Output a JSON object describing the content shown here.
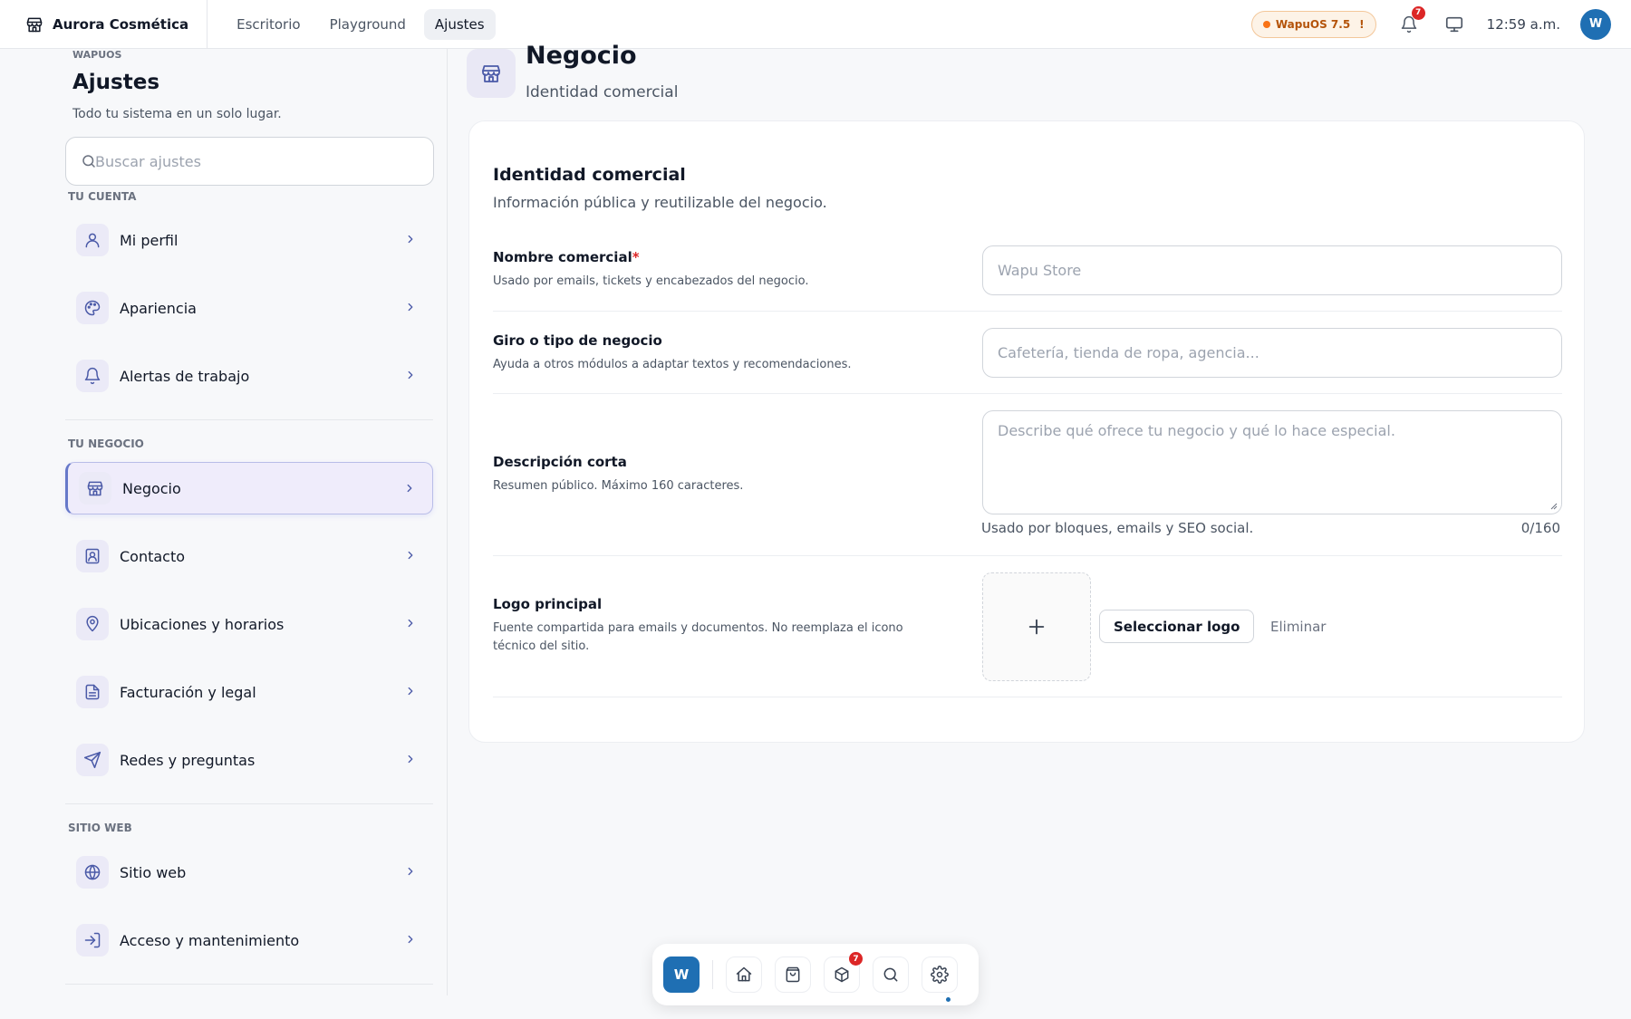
{
  "topbar": {
    "brand": "Aurora Cosmética",
    "tabs": [
      {
        "label": "Escritorio",
        "active": false
      },
      {
        "label": "Playground",
        "active": false
      },
      {
        "label": "Ajustes",
        "active": true
      }
    ],
    "version": "WapuOS 7.5",
    "version_alert": "!",
    "notifications_count": "7",
    "clock": "12:59 a.m.",
    "avatar_initial": "W",
    "accent_color": "#1f6fb3"
  },
  "sidebar": {
    "eyebrow": "WAPUOS",
    "title": "Ajustes",
    "subtitle": "Todo tu sistema en un solo lugar.",
    "search_placeholder": "Buscar ajustes",
    "sections": [
      {
        "title": "TU CUENTA",
        "items": [
          {
            "label": "Mi perfil",
            "icon": "user-icon"
          },
          {
            "label": "Apariencia",
            "icon": "palette-icon"
          },
          {
            "label": "Alertas de trabajo",
            "icon": "bell-icon"
          }
        ]
      },
      {
        "title": "TU NEGOCIO",
        "items": [
          {
            "label": "Negocio",
            "icon": "store-icon",
            "active": true
          },
          {
            "label": "Contacto",
            "icon": "contact-icon"
          },
          {
            "label": "Ubicaciones y horarios",
            "icon": "map-pin-icon"
          },
          {
            "label": "Facturación y legal",
            "icon": "document-icon"
          },
          {
            "label": "Redes y preguntas",
            "icon": "send-icon"
          }
        ]
      },
      {
        "title": "SITIO WEB",
        "items": [
          {
            "label": "Sitio web",
            "icon": "globe-icon"
          },
          {
            "label": "Acceso y mantenimiento",
            "icon": "login-icon"
          }
        ]
      }
    ]
  },
  "page": {
    "title": "Negocio",
    "subtitle": "Identidad comercial"
  },
  "card": {
    "title": "Identidad comercial",
    "subtitle": "Información pública y reutilizable del negocio.",
    "fields": {
      "nombre": {
        "label": "Nombre comercial",
        "required_mark": "*",
        "help": "Usado por emails, tickets y encabezados del negocio.",
        "placeholder": "Wapu Store",
        "value": ""
      },
      "giro": {
        "label": "Giro o tipo de negocio",
        "help": "Ayuda a otros módulos a adaptar textos y recomendaciones.",
        "placeholder": "Cafetería, tienda de ropa, agencia...",
        "value": ""
      },
      "descripcion": {
        "label": "Descripción corta",
        "help": "Resumen público. Máximo 160 caracteres.",
        "placeholder": "Describe qué ofrece tu negocio y qué lo hace especial.",
        "value": "",
        "hint": "Usado por bloques, emails y SEO social.",
        "counter": "0/160"
      },
      "logo": {
        "label": "Logo principal",
        "help": "Fuente compartida para emails y documentos. No reemplaza el icono técnico del sitio.",
        "select_label": "Seleccionar logo",
        "delete_label": "Eliminar"
      }
    }
  },
  "dock": {
    "app_initial": "W",
    "items": [
      "home-icon",
      "bag-icon",
      "box-icon",
      "search-icon",
      "gear-icon"
    ],
    "box_badge": "7",
    "active": "gear-icon"
  }
}
